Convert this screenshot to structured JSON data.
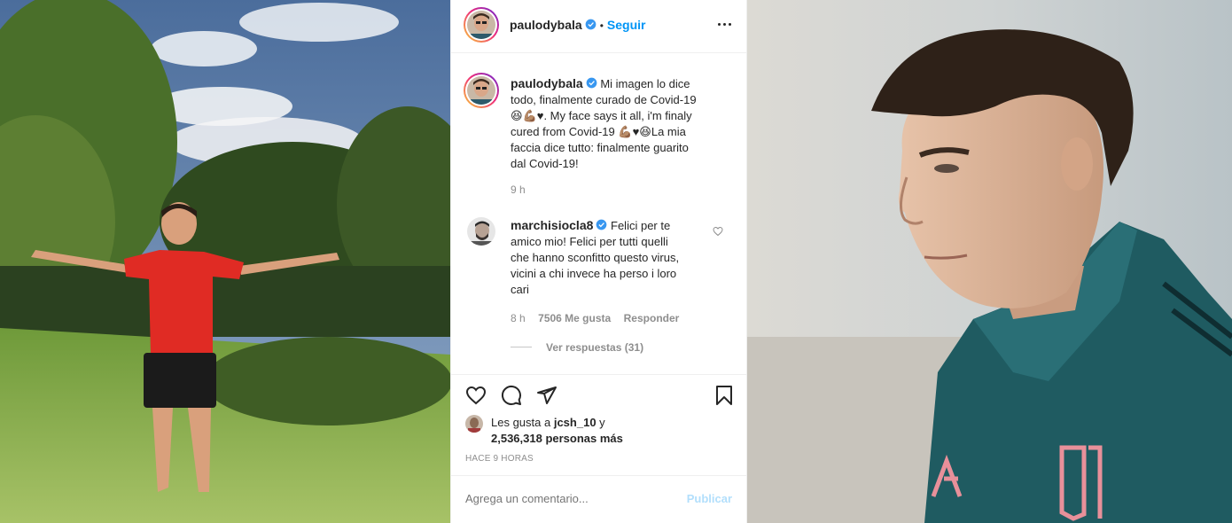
{
  "post": {
    "username": "paulodybala",
    "follow_label": "Seguir",
    "dot": "•",
    "caption_lines": [
      "Mi imagen lo dice",
      "todo, finalmente curado de Covid-19",
      "😆💪🏽♥. My face says it all, i'm finaly",
      "cured from Covid-19 💪🏽♥😆La mia",
      "faccia dice tutto: finalmente guarito",
      "dal Covid-19!"
    ],
    "caption_time": "9 h"
  },
  "comment": {
    "username": "marchisiocla8",
    "text_lines": [
      "Felici per te",
      "amico mio! Felici per tutti quelli",
      "che hanno sconfitto questo virus,",
      "vicini a chi invece ha perso i loro",
      "cari"
    ],
    "time": "8 h",
    "likes": "7506 Me gusta",
    "reply_label": "Responder",
    "view_replies": "Ver respuestas (31)"
  },
  "likes": {
    "prefix": "Les gusta a",
    "first_user": "jcsh_10",
    "conj": "y",
    "count_text": "2,536,318 personas más"
  },
  "timestamp": "HACE 9 HORAS",
  "comment_box": {
    "placeholder": "Agrega un comentario...",
    "publish_label": "Publicar"
  },
  "colors": {
    "link_blue": "#0095f6",
    "publish_disabled": "#b2dffc",
    "verified_blue": "#3897f0",
    "muted": "#8e8e8e",
    "text": "#262626"
  },
  "icons": [
    "heart-icon",
    "comment-icon",
    "share-icon",
    "bookmark-icon",
    "more-options-icon",
    "verified-icon"
  ]
}
